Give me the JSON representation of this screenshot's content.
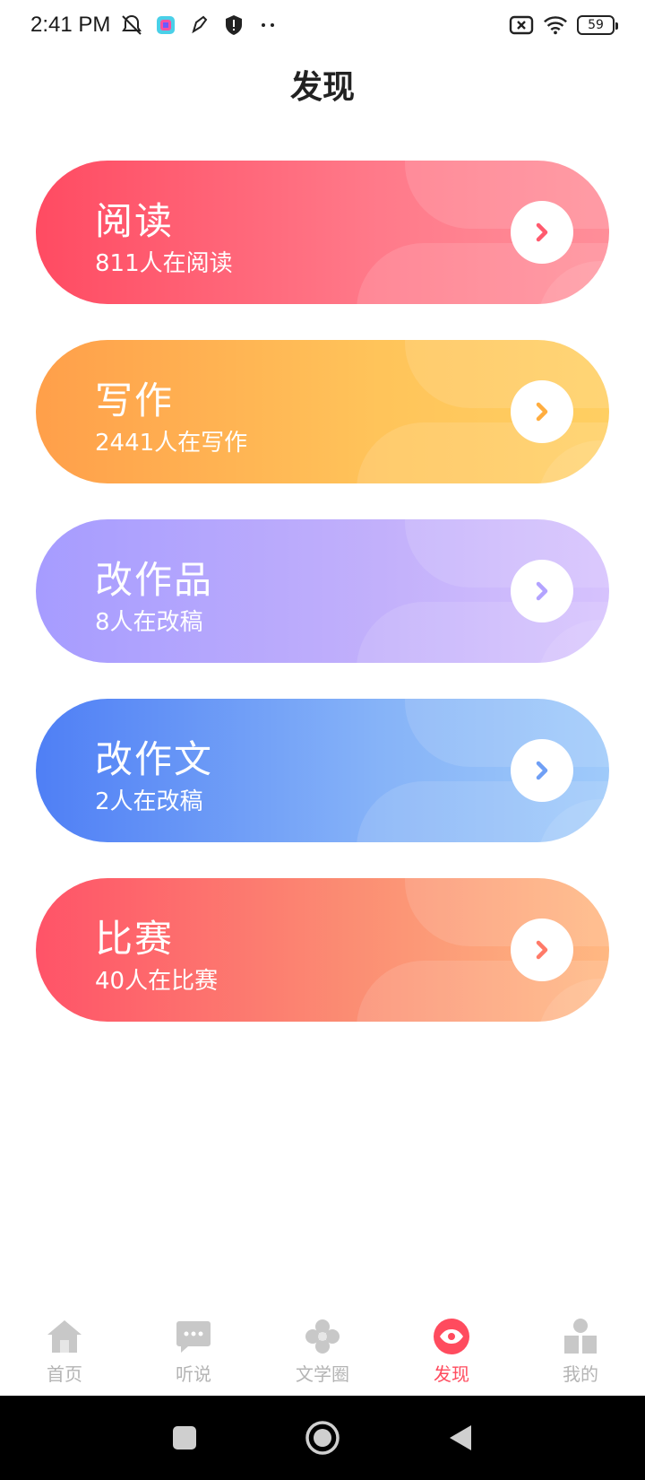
{
  "status_bar": {
    "time": "2:41 PM",
    "battery": "59"
  },
  "page": {
    "title": "发现"
  },
  "cards": [
    {
      "title": "阅读",
      "subtitle": "811人在阅读",
      "arrow_color": "#ff5a6e"
    },
    {
      "title": "写作",
      "subtitle": "2441人在写作",
      "arrow_color": "#ffad3f"
    },
    {
      "title": "改作品",
      "subtitle": "8人在改稿",
      "arrow_color": "#b3a3ff"
    },
    {
      "title": "改作文",
      "subtitle": "2人在改稿",
      "arrow_color": "#6f9ff5"
    },
    {
      "title": "比赛",
      "subtitle": "40人在比赛",
      "arrow_color": "#ff7a68"
    }
  ],
  "bottom_nav": {
    "items": [
      {
        "label": "首页",
        "icon": "home-icon"
      },
      {
        "label": "听说",
        "icon": "chat-icon"
      },
      {
        "label": "文学圈",
        "icon": "flower-icon"
      },
      {
        "label": "发现",
        "icon": "eye-icon",
        "active": true
      },
      {
        "label": "我的",
        "icon": "profile-icon"
      }
    ],
    "active_color": "#ff4b5e",
    "inactive_color": "#b4b4b4"
  }
}
